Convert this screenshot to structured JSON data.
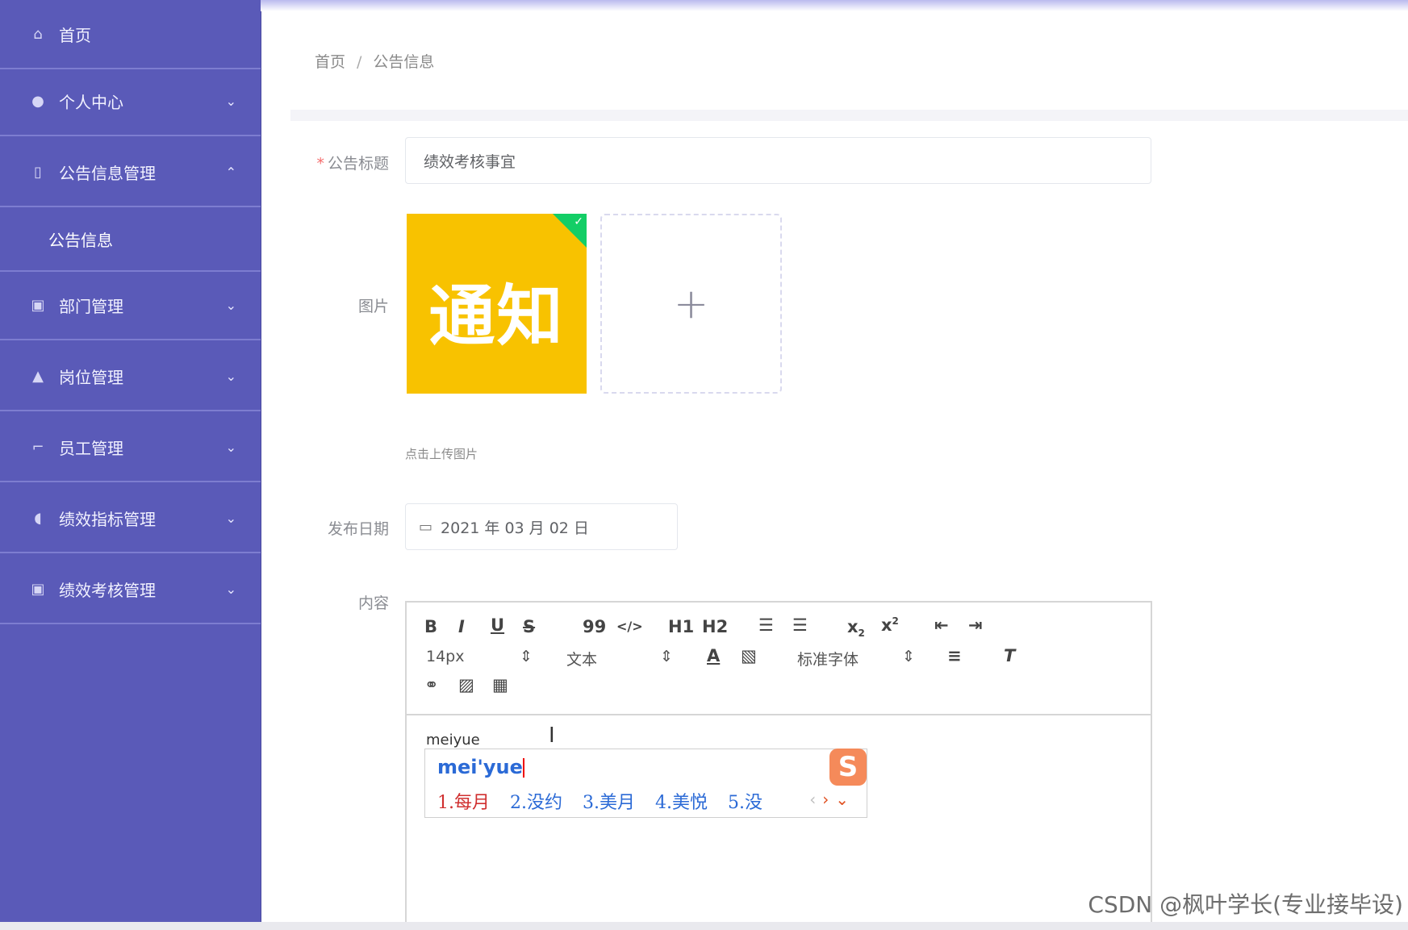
{
  "sidebar": {
    "items": [
      {
        "label": "首页",
        "icon": "home-icon"
      },
      {
        "label": "个人中心",
        "icon": "user-icon",
        "expanded": false
      },
      {
        "label": "公告信息管理",
        "icon": "notice-icon",
        "expanded": true
      },
      {
        "label": "公告信息",
        "sub": true,
        "active": true
      },
      {
        "label": "部门管理",
        "icon": "clipboard-icon",
        "expanded": false
      },
      {
        "label": "岗位管理",
        "icon": "person-icon",
        "expanded": false
      },
      {
        "label": "员工管理",
        "icon": "crop-icon",
        "expanded": false
      },
      {
        "label": "绩效指标管理",
        "icon": "bell-icon",
        "expanded": false
      },
      {
        "label": "绩效考核管理",
        "icon": "clipboard-icon",
        "expanded": false
      }
    ]
  },
  "breadcrumb": {
    "home": "首页",
    "separator": "/",
    "current": "公告信息"
  },
  "form": {
    "title_label": "公告标题",
    "title_required_mark": "*",
    "title_value": "绩效考核事宜",
    "image_label": "图片",
    "image_thumb_text": "通知",
    "upload_plus": "+",
    "upload_tip": "点击上传图片",
    "date_label": "发布日期",
    "date_value": "2021 年 03 月 02 日",
    "content_label": "内容"
  },
  "editor": {
    "toolbar_row1": [
      "B",
      "I",
      "U",
      "S",
      "99",
      "</>",
      "H1",
      "H2",
      "ol",
      "ul",
      "x2",
      "x2",
      "outdent",
      "indent"
    ],
    "font_size": "14px",
    "header_select": "文本",
    "font_family": "标准字体",
    "body_text": "meiyue"
  },
  "ime": {
    "composition": "mei'yue",
    "candidates": [
      "1.每月",
      "2.没约",
      "3.美月",
      "4.美悦",
      "5.没"
    ],
    "logo": "S"
  },
  "watermark": "CSDN @枫叶学长(专业接毕设)",
  "colors": {
    "sidebar": "#5a5ab8",
    "accent": "#2b6ad6",
    "success": "#13ce66",
    "required": "#f56c6c"
  }
}
